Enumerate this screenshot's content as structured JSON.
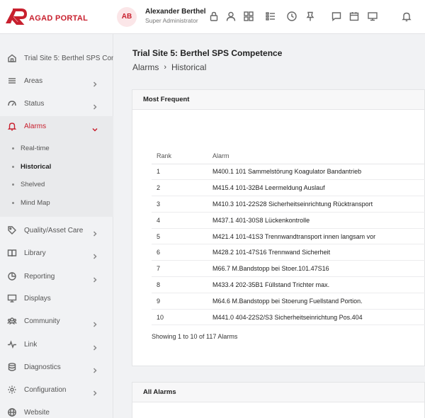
{
  "brand": {
    "logo_text": "AGAD PORTAL",
    "accent": "#c8202e"
  },
  "user": {
    "initials": "AB",
    "name": "Alexander Berthel",
    "role": "Super Administrator"
  },
  "header_icons": [
    "lock-icon",
    "user-icon",
    "grid-icon",
    "list-icon",
    "clock-icon",
    "pin-icon",
    "chat-icon",
    "calendar-icon",
    "monitor-icon",
    "bell-icon"
  ],
  "sidebar": {
    "site": "Trial Site 5: Berthel SPS Con",
    "items": [
      {
        "label": "Areas"
      },
      {
        "label": "Status"
      },
      {
        "label": "Alarms"
      },
      {
        "label": "Quality/Asset Care"
      },
      {
        "label": "Library"
      },
      {
        "label": "Reporting"
      },
      {
        "label": "Displays"
      },
      {
        "label": "Community"
      },
      {
        "label": "Link"
      },
      {
        "label": "Diagnostics"
      },
      {
        "label": "Configuration"
      },
      {
        "label": "Website"
      }
    ],
    "alarm_subitems": [
      {
        "label": "Real-time"
      },
      {
        "label": "Historical"
      },
      {
        "label": "Shelved"
      },
      {
        "label": "Mind Map"
      }
    ]
  },
  "page": {
    "title": "Trial Site 5: Berthel SPS Competence",
    "breadcrumb": [
      "Alarms",
      "Historical"
    ]
  },
  "most_frequent": {
    "heading": "Most Frequent",
    "columns": [
      "Rank",
      "Alarm"
    ],
    "rows": [
      {
        "rank": "1",
        "alarm": "M400.1 101 Sammelstörung Koagulator Bandantrieb"
      },
      {
        "rank": "2",
        "alarm": "M415.4 101-32B4 Leermeldung Auslauf"
      },
      {
        "rank": "3",
        "alarm": "M410.3 101-22S28 Sicherheitseinrichtung Rücktransport"
      },
      {
        "rank": "4",
        "alarm": "M437.1 401-30S8 Lückenkontrolle"
      },
      {
        "rank": "5",
        "alarm": "M421.4 101-41S3 Trennwandtransport innen langsam vor"
      },
      {
        "rank": "6",
        "alarm": "M428.2 101-47S16 Trennwand Sicherheit"
      },
      {
        "rank": "7",
        "alarm": "M66.7 M.Bandstopp bei Stoer.101.47S16"
      },
      {
        "rank": "8",
        "alarm": "M433.4 202-35B1 Füllstand Trichter max."
      },
      {
        "rank": "9",
        "alarm": "M64.6 M.Bandstopp bei Stoerung Fuellstand Portion."
      },
      {
        "rank": "10",
        "alarm": "M441.0 404-22S2/S3 Sicherheitseinrichtung Pos.404"
      }
    ],
    "footer": "Showing 1 to 10 of 117 Alarms"
  },
  "all_alarms": {
    "heading": "All Alarms"
  }
}
